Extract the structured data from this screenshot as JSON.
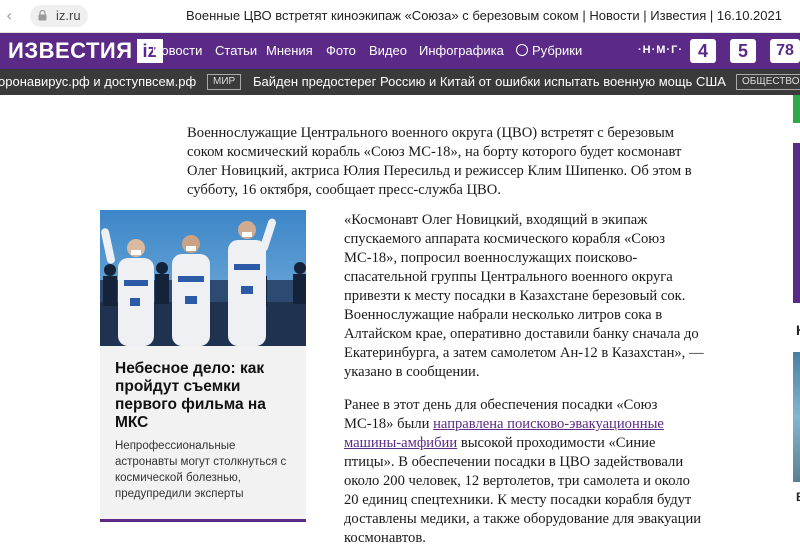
{
  "browser": {
    "url": "iz.ru",
    "page_title": "Военные ЦВО встретят киноэкипаж «Союза» с березовым соком | Новости | Известия | 16.10.2021"
  },
  "header": {
    "logo_text": "ИЗВЕСТИЯ",
    "logo_box": "iz",
    "nav": [
      "Новости",
      "Статьи",
      "Мнения",
      "Фото",
      "Видео",
      "Инфографика",
      "Рубрики"
    ],
    "nmg": "·Н·М·Г·",
    "channels": [
      "4",
      "5",
      "78"
    ],
    "brand_color": "#5a2a86"
  },
  "ticker": {
    "item_left": "оронавирус.рф и доступвсем.рф",
    "tag1": "МИР",
    "item_main": "Байден предостерег Россию и Китай от ошибки испытать военную мощь США",
    "tag2": "ОБЩЕСТВО"
  },
  "article": {
    "lead": "Военнослужащие Центрального военного округа (ЦВО) встретят с березовым соком космический корабль «Союз МС-18», на борту которого будет космонавт Олег Новицкий, актриса Юлия Пересильд и режиссер Клим Шипенко. Об этом в субботу, 16 октября, сообщает пресс-служба ЦВО.",
    "quote": "«Космонавт Олег Новицкий, входящий в экипаж спускаемого аппарата космического корабля «Союз МС-18», попросил военнослужащих поисково-спасательной группы Центрального военного округа привезти к месту посадки в Казахстане березовый сок. Военнослужащие набрали несколько литров сока в Алтайском крае, оперативно доставили банку сначала до Екатеринбурга, а затем самолетом Ан-12 в Казахстан», — указано в сообщении.",
    "p3_before": "Ранее в этот день для обеспечения посадки «Союз МС-18» были ",
    "p3_link": "направлена поисково-эвакуационные машины-амфибии",
    "p3_after": " высокой проходимости «Синие птицы». В обеспечении посадки в ЦВО задействовали около 200 человек, 12 вертолетов, три самолета и около 20 единиц спецтехники. К месту посадки корабля будут доставлены медики, а также оборудование для эвакуации космонавтов."
  },
  "card": {
    "title": "Небесное дело: как пройдут съемки первого фильма на МКС",
    "text": "Непрофессиональные астронавты могут столкнуться с космической болезнью, предупредили эксперты"
  },
  "right_strip": {
    "letter1": "К",
    "letter2": "В"
  }
}
